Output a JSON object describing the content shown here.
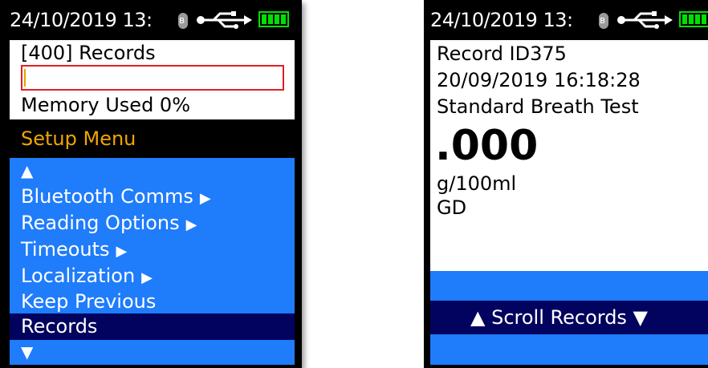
{
  "left_screen": {
    "status": {
      "datetime": "24/10/2019  13:"
    },
    "records_label": "[400] Records",
    "memory_label": "Memory Used 0%",
    "menu_title": "Setup Menu",
    "menu_title_color": "#f0a500",
    "scroll_up_glyph": "▲",
    "scroll_down_glyph": "▼",
    "submenu_glyph": "▶",
    "menu_items": [
      {
        "label": "Bluetooth Comms",
        "has_submenu": true
      },
      {
        "label": "Reading Options",
        "has_submenu": true
      },
      {
        "label": "Timeouts",
        "has_submenu": true
      },
      {
        "label": "Localization",
        "has_submenu": true
      },
      {
        "label": "Keep Previous",
        "has_submenu": false
      },
      {
        "label": "Records",
        "has_submenu": false,
        "selected": true
      }
    ]
  },
  "right_screen": {
    "status": {
      "datetime": "24/10/2019  13:"
    },
    "record_id": "Record ID375",
    "record_datetime": "20/09/2019  16:18:28",
    "test_type": "Standard Breath Test",
    "reading_value": ".000",
    "reading_unit": "g/100ml",
    "initials": "GD",
    "scroll_label": "▲ Scroll Records ▼"
  },
  "colors": {
    "screen_bg": "#000000",
    "menu_blue": "#1f7cfb",
    "selection_navy": "#02035e",
    "battery_green": "#00e000",
    "progress_border": "#e02020"
  },
  "icons": [
    "bluetooth-icon",
    "usb-icon",
    "battery-icon"
  ],
  "memory_used_fraction": 0
}
